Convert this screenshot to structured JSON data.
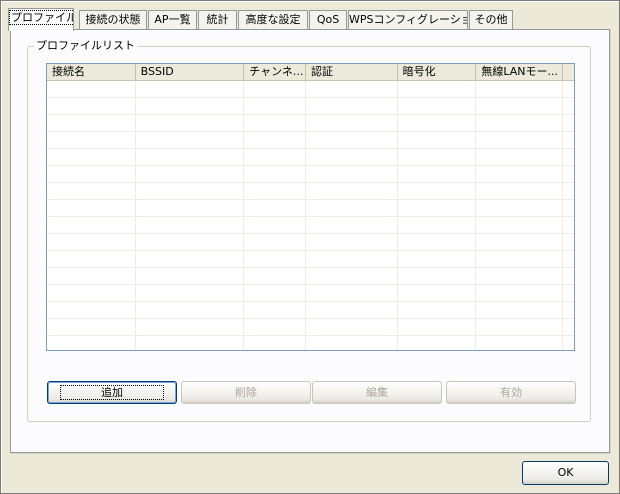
{
  "tabs": [
    {
      "label": "プロファイル",
      "active": true
    },
    {
      "label": "接続の状態",
      "active": false
    },
    {
      "label": "AP一覧",
      "active": false
    },
    {
      "label": "統計",
      "active": false
    },
    {
      "label": "高度な設定",
      "active": false
    },
    {
      "label": "QoS",
      "active": false
    },
    {
      "label": "WPSコンフィグレーション",
      "active": false
    },
    {
      "label": "その他",
      "active": false
    }
  ],
  "profile_list": {
    "title": "プロファイルリスト",
    "columns": [
      "接続名",
      "BSSID",
      "チャンネ...",
      "認証",
      "暗号化",
      "無線LANモー..."
    ],
    "rows": []
  },
  "buttons": {
    "add": {
      "label": "追加",
      "enabled": true
    },
    "delete": {
      "label": "削除",
      "enabled": false
    },
    "edit": {
      "label": "編集",
      "enabled": false
    },
    "activate": {
      "label": "有効",
      "enabled": false
    }
  },
  "ok_button": {
    "label": "OK"
  }
}
